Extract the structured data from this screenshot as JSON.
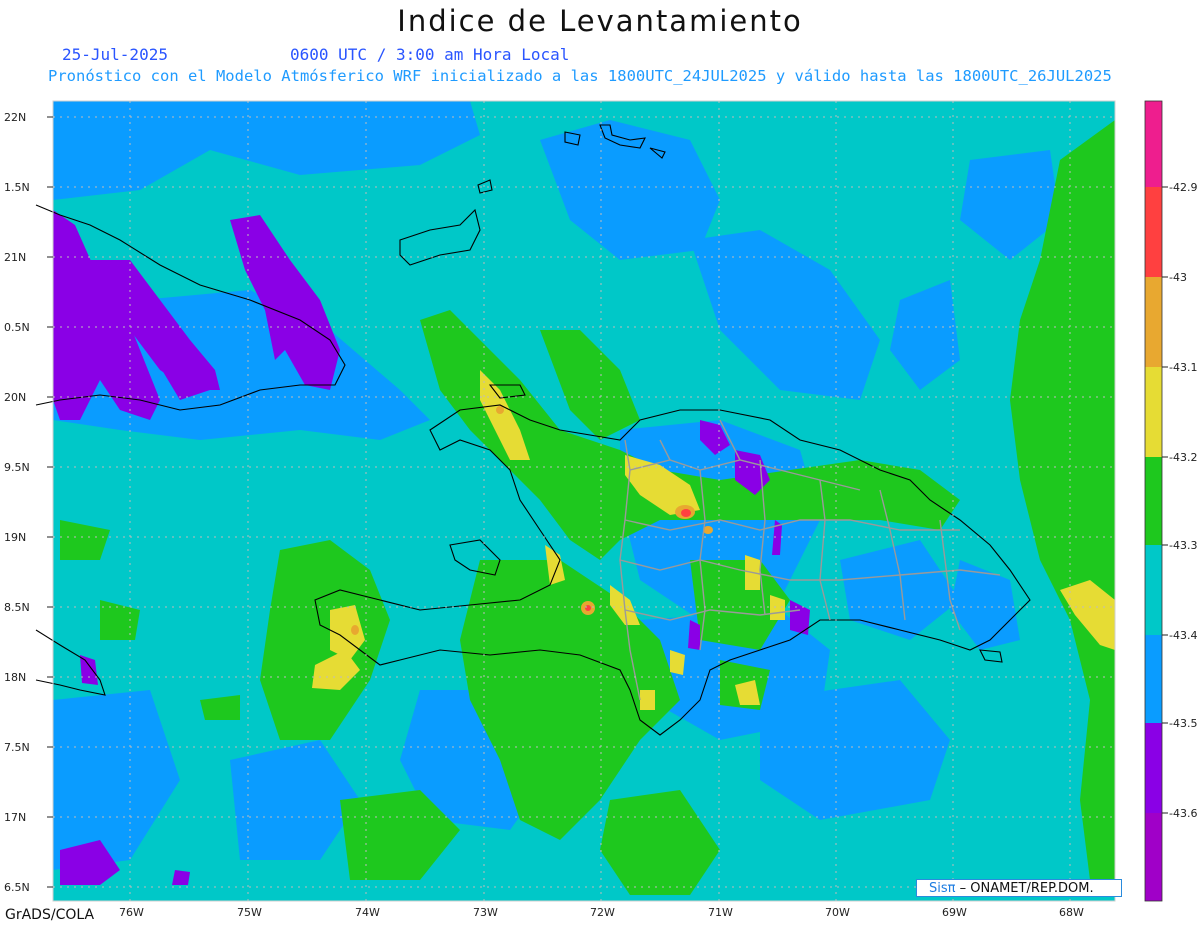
{
  "title": "Indice de Levantamiento",
  "date": "25-Jul-2025",
  "time": "0600 UTC / 3:00 am Hora Local",
  "subtitle": "Pronóstico con el Modelo Atmósferico WRF inicializado a las 1800UTC_24JUL2025 y válido hasta las  1800UTC_26JUL2025",
  "footer": "GrADS/COLA",
  "credit": {
    "brand": "Sisπ",
    "text": " – ONAMET/REP.DOM."
  },
  "axes": {
    "lon_labels": [
      "76W",
      "75W",
      "74W",
      "73W",
      "72W",
      "71W",
      "70W",
      "69W",
      "68W"
    ],
    "lat_labels": [
      "22N",
      "1.5N",
      "21N",
      "0.5N",
      "20N",
      "9.5N",
      "19N",
      "8.5N",
      "18N",
      "7.5N",
      "17N",
      "6.5N"
    ]
  },
  "legend": {
    "labels": [
      "-42.9",
      "-43",
      "-43.1",
      "-43.2",
      "-43.3",
      "-43.4",
      "-43.5",
      "-43.6"
    ],
    "colors": [
      "#ee1e8e",
      "#ff4040",
      "#e8a830",
      "#e6dc34",
      "#1ec81e",
      "#00c8c8",
      "#0a9cff",
      "#8a00e6",
      "#a000c8"
    ]
  },
  "field_colors": {
    "background": "#00c8c8",
    "blue": "#0a9cff",
    "green": "#1ec81e",
    "yellow": "#e6dc34",
    "orange": "#e8a830",
    "red": "#ff4040",
    "purple": "#8a00e6"
  }
}
